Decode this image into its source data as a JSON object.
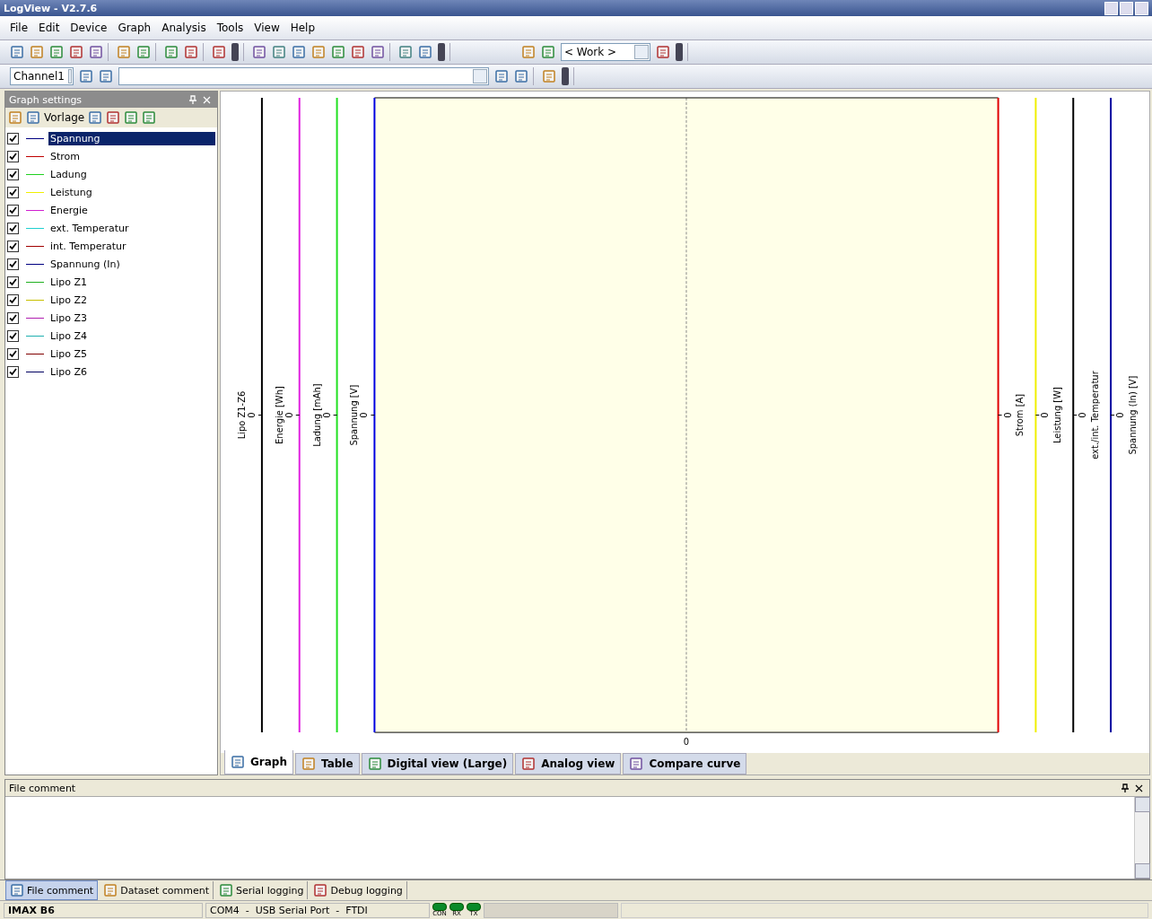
{
  "window": {
    "title": "LogView - V2.7.6"
  },
  "menu": [
    "File",
    "Edit",
    "Device",
    "Graph",
    "Analysis",
    "Tools",
    "View",
    "Help"
  ],
  "toolbar": {
    "work_combo": "< Work >"
  },
  "channel_bar": {
    "channel_combo": "Channel1"
  },
  "graph_settings": {
    "title": "Graph settings",
    "template_label": "Vorlage",
    "curves": [
      {
        "label": "Spannung",
        "color": "#000080",
        "checked": true,
        "selected": true
      },
      {
        "label": "Strom",
        "color": "#c00000",
        "checked": true,
        "selected": false
      },
      {
        "label": "Ladung",
        "color": "#20d020",
        "checked": true,
        "selected": false
      },
      {
        "label": "Leistung",
        "color": "#f0f000",
        "checked": true,
        "selected": false
      },
      {
        "label": "Energie",
        "color": "#d020d0",
        "checked": true,
        "selected": false
      },
      {
        "label": "ext. Temperatur",
        "color": "#20d0d0",
        "checked": true,
        "selected": false
      },
      {
        "label": "int. Temperatur",
        "color": "#a00000",
        "checked": true,
        "selected": false
      },
      {
        "label": "Spannung (In)",
        "color": "#000080",
        "checked": true,
        "selected": false
      },
      {
        "label": "Lipo Z1",
        "color": "#20b020",
        "checked": true,
        "selected": false
      },
      {
        "label": "Lipo Z2",
        "color": "#c8c000",
        "checked": true,
        "selected": false
      },
      {
        "label": "Lipo Z3",
        "color": "#b020b0",
        "checked": true,
        "selected": false
      },
      {
        "label": "Lipo Z4",
        "color": "#20b0b0",
        "checked": true,
        "selected": false
      },
      {
        "label": "Lipo Z5",
        "color": "#800000",
        "checked": true,
        "selected": false
      },
      {
        "label": "Lipo Z6",
        "color": "#000060",
        "checked": true,
        "selected": false
      }
    ]
  },
  "graph": {
    "axes_left": [
      {
        "label": "Lipo Z1-Z6",
        "tick": "0",
        "color": "#000000"
      },
      {
        "label": "Energie  [Wh]",
        "tick": "0",
        "color": "#e020e0"
      },
      {
        "label": "Ladung  [mAh]",
        "tick": "0",
        "color": "#20e020"
      },
      {
        "label": "Spannung  [V]",
        "tick": "0",
        "color": "#0000e0"
      }
    ],
    "axes_right": [
      {
        "label": "Strom  [A]",
        "tick": "0",
        "color": "#e00000"
      },
      {
        "label": "Leistung  [W]",
        "tick": "0",
        "color": "#f0f000"
      },
      {
        "label": "ext./int. Temperatur",
        "tick": "0",
        "color": "#000000"
      },
      {
        "label": "Spannung (In)  [V]",
        "tick": "0",
        "color": "#0000a0"
      }
    ],
    "x_tick": "0"
  },
  "view_tabs": [
    {
      "label": "Graph",
      "selected": true
    },
    {
      "label": "Table",
      "selected": false
    },
    {
      "label": "Digital view (Large)",
      "selected": false
    },
    {
      "label": "Analog view",
      "selected": false
    },
    {
      "label": "Compare curve",
      "selected": false
    }
  ],
  "comment_panel": {
    "title": "File comment"
  },
  "bottom_tabs": [
    {
      "label": "File comment",
      "selected": true
    },
    {
      "label": "Dataset comment",
      "selected": false
    },
    {
      "label": "Serial logging",
      "selected": false
    },
    {
      "label": "Debug logging",
      "selected": false
    }
  ],
  "status_bar": {
    "device": "IMAX B6",
    "port": "COM4  -  USB Serial Port  -  FTDI",
    "indicators": [
      "CON",
      "RX",
      "TX"
    ]
  }
}
